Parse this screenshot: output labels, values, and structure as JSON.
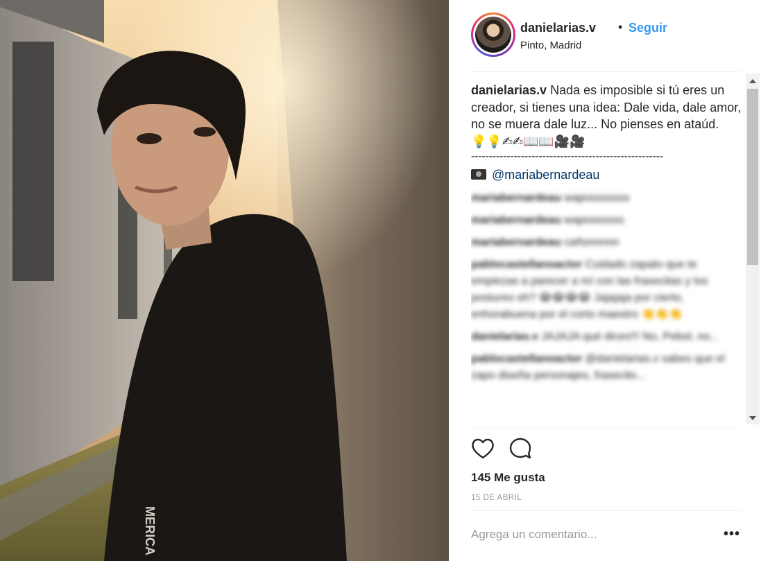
{
  "post": {
    "username": "danielarias.v",
    "dot": "•",
    "follow_label": "Seguir",
    "location": "Pinto, Madrid"
  },
  "caption": {
    "username": "danielarias.v",
    "text": " Nada es imposible si tú eres un creador, si tienes una idea: Dale vida, dale amor, no se muera dale luz... No pienses en ataúd.",
    "emojis": "💡💡✍✍📖📖🎥🎥",
    "dashes": "------------------------------------------------------",
    "credit_mention": "@mariabernardeau"
  },
  "comments": [
    {
      "user": "mariabernardeau",
      "text": "waposssssss"
    },
    {
      "user": "mariabernardeau",
      "text": "wapossssss"
    },
    {
      "user": "mariabernardeau",
      "text": "cañonnnnn"
    },
    {
      "user": "pablocastellanoactor",
      "text": "Cuidado zapato que te empiezas a parecer a mí con las frasecitas y los postureo eh? 😂😂😂😂 Jajajaja por cierto, enhorabuena por el corto maestro",
      "emoji": "👏👏👏"
    },
    {
      "user": "danielarias.v",
      "text": "JAJAJA qué dices!!! No, Pebol, no..."
    },
    {
      "user": "pablocastellanoactor",
      "text": "@danielarias.v sabes que el zapo diseña personajes, frasecito..."
    }
  ],
  "actions": {
    "likes": "145 Me gusta",
    "date": "15 DE ABRIL"
  },
  "add_comment": {
    "placeholder": "Agrega un comentario...",
    "more": "•••"
  }
}
